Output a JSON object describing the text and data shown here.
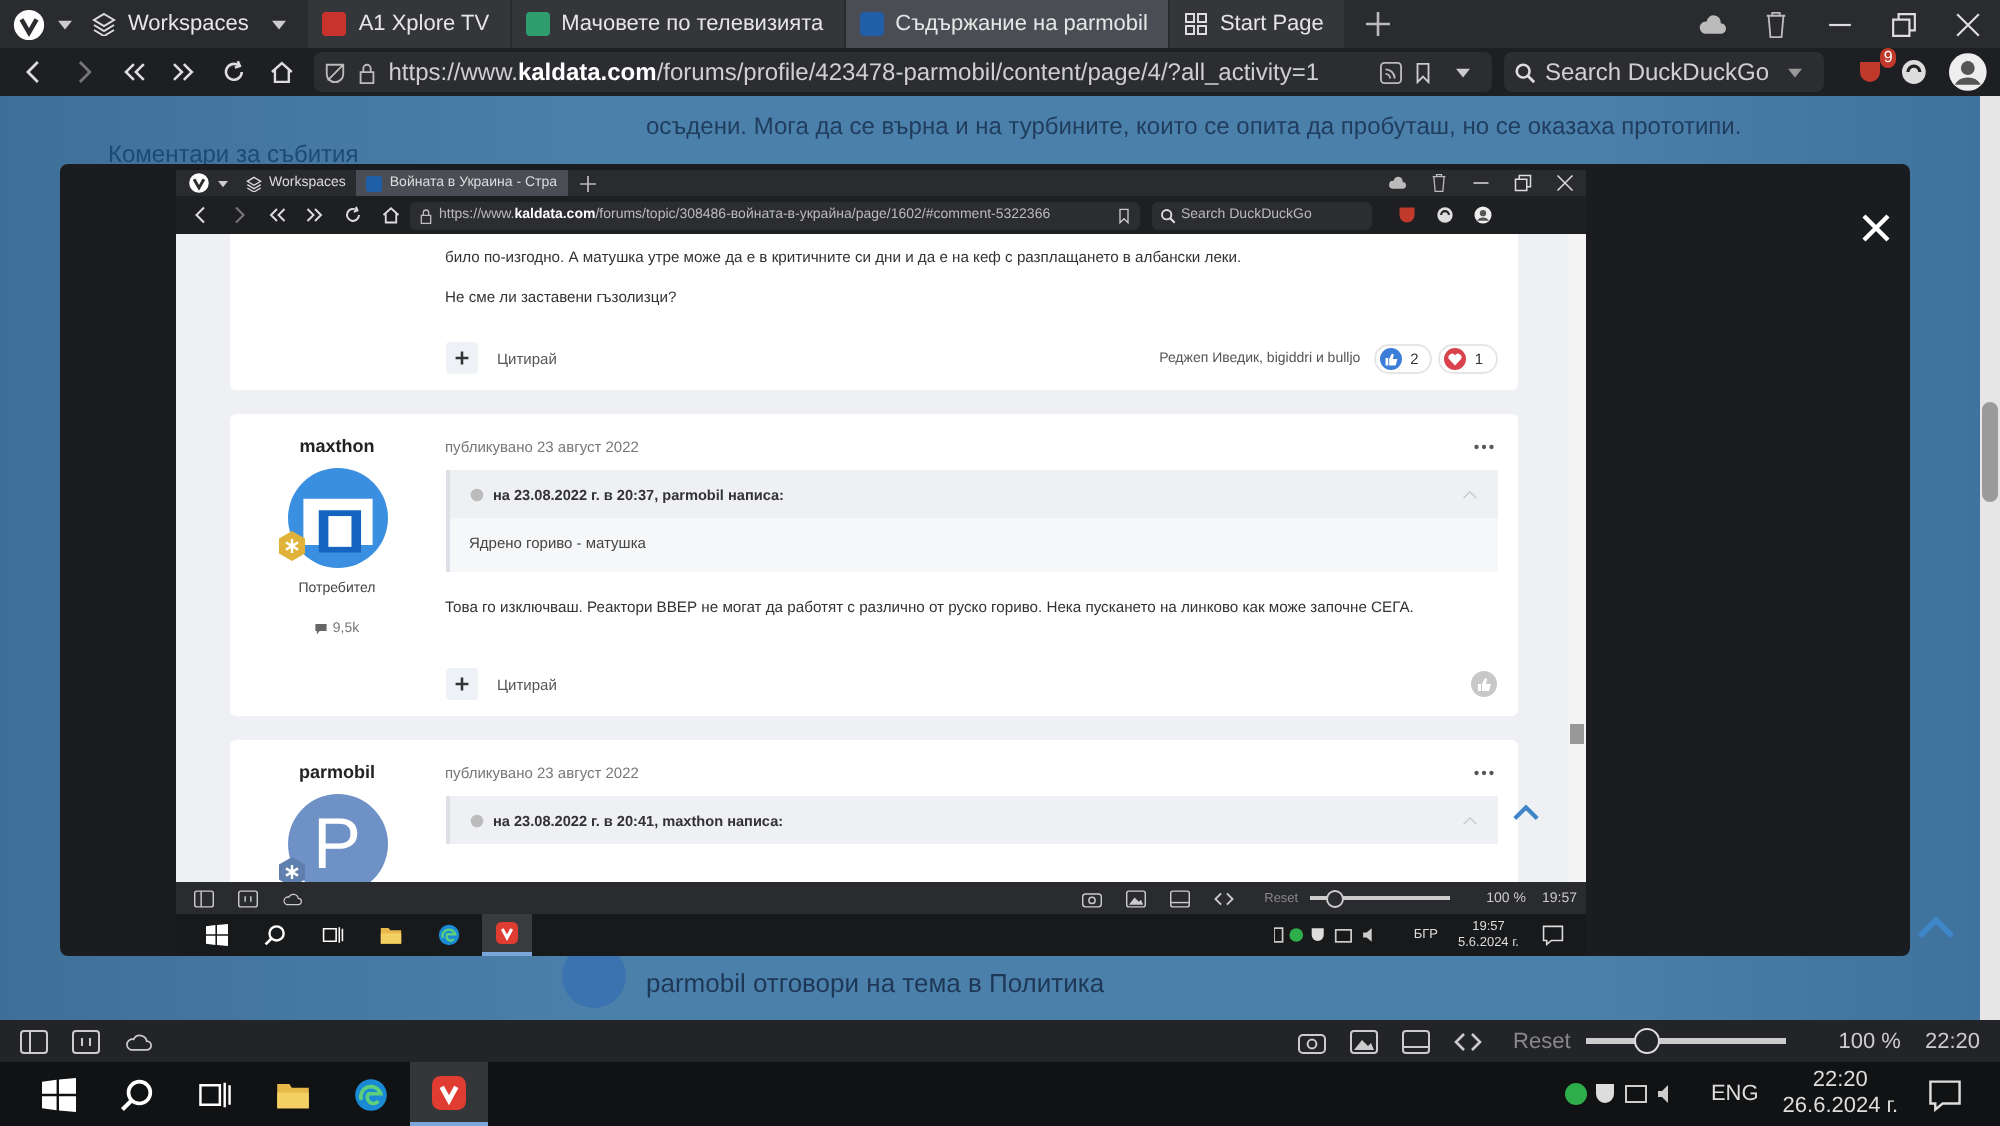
{
  "browser": {
    "tabs": [
      {
        "kind": "workspaces",
        "label": "Workspaces",
        "selected": false
      },
      {
        "kind": "page",
        "label": "A1 Xplore TV",
        "color": "#c8332e",
        "selected": false
      },
      {
        "kind": "page",
        "label": "Мачовете по телевизията",
        "color": "#2f9e6e",
        "selected": false
      },
      {
        "kind": "page",
        "label": "Съдържание на parmobil",
        "color": "#1f5fa8",
        "selected": true
      },
      {
        "kind": "start",
        "label": "Start Page",
        "selected": false
      }
    ],
    "url": "https://www.**kaldata.com**/forums/profile/423478-parmobil/content/page/4/?all_activity=1",
    "search": {
      "placeholder": "Search DuckDuckGo"
    },
    "extension_badge": "9"
  },
  "page": {
    "text_top": "осъдени. Мога да се върна и на турбините, които се опита да пробуташ, но се оказаха прототипи.",
    "sidebar_link": "Коментари за събития",
    "activity": "parmobil отговори на тема в Политика"
  },
  "lightbox": {
    "screenshot": {
      "tabs": [
        {
          "kind": "workspaces",
          "label": "Workspaces",
          "selected": false
        },
        {
          "kind": "page",
          "label": "Войната в Украина - Стра",
          "color": "#1f5fa8",
          "selected": true
        }
      ],
      "url": "https://www.**kaldata.com**/forums/topic/308486-войната-в-украйна/page/1602/#comment-5322366",
      "search": {
        "placeholder": "Search DuckDuckGo"
      },
      "posts": [
        {
          "kind": "partial",
          "lines": [
            "било по-изгодно. А матушка утре може да е в критичните си дни и да е на кеф с разплащането в албански леки.",
            "Не сме ли заставени гъзолизци?"
          ],
          "quote_button": "Цитирай",
          "reacted_by": "Реджеп Иведик, bigiddri и bulljo",
          "reactions": [
            {
              "kind": "like",
              "count": "2"
            },
            {
              "kind": "love",
              "count": "1"
            }
          ]
        },
        {
          "kind": "full",
          "author": "maxthon",
          "avatar": {
            "kind": "logo"
          },
          "role": "Потребител",
          "posts_count": "9,5k",
          "date": "публикувано 23 август 2022",
          "quote": {
            "header": "на 23.08.2022 г. в 20:37, parmobil написа:",
            "text": "Ядрено гориво - матушка"
          },
          "lines": [
            "Това го изключваш. Реактори ВВЕР не могат да работят с различно от руско гориво. Нека пускането на линково как може започне СЕГА."
          ],
          "quote_button": "Цитирай"
        },
        {
          "kind": "clipped",
          "author": "parmobil",
          "avatar": {
            "kind": "letter",
            "letter": "P"
          },
          "date": "публикувано 23 август 2022",
          "quote": {
            "header": "на 23.08.2022 г. в 20:41, maxthon написа:"
          }
        }
      ],
      "status_bar": {
        "reset": "Reset",
        "zoom_slider": {
          "level": 0.17
        },
        "zoom": "100 %",
        "time": "19:57"
      },
      "taskbar": {
        "language": "БГР",
        "time": "19:57",
        "date": "5.6.2024 г."
      }
    }
  },
  "status_bar": {
    "reset": "Reset",
    "zoom_slider": {
      "level": 0.3
    },
    "zoom": "100 %",
    "time": "22:20"
  },
  "taskbar": {
    "language": "ENG",
    "time": "22:20",
    "date": "26.6.2024 г."
  }
}
